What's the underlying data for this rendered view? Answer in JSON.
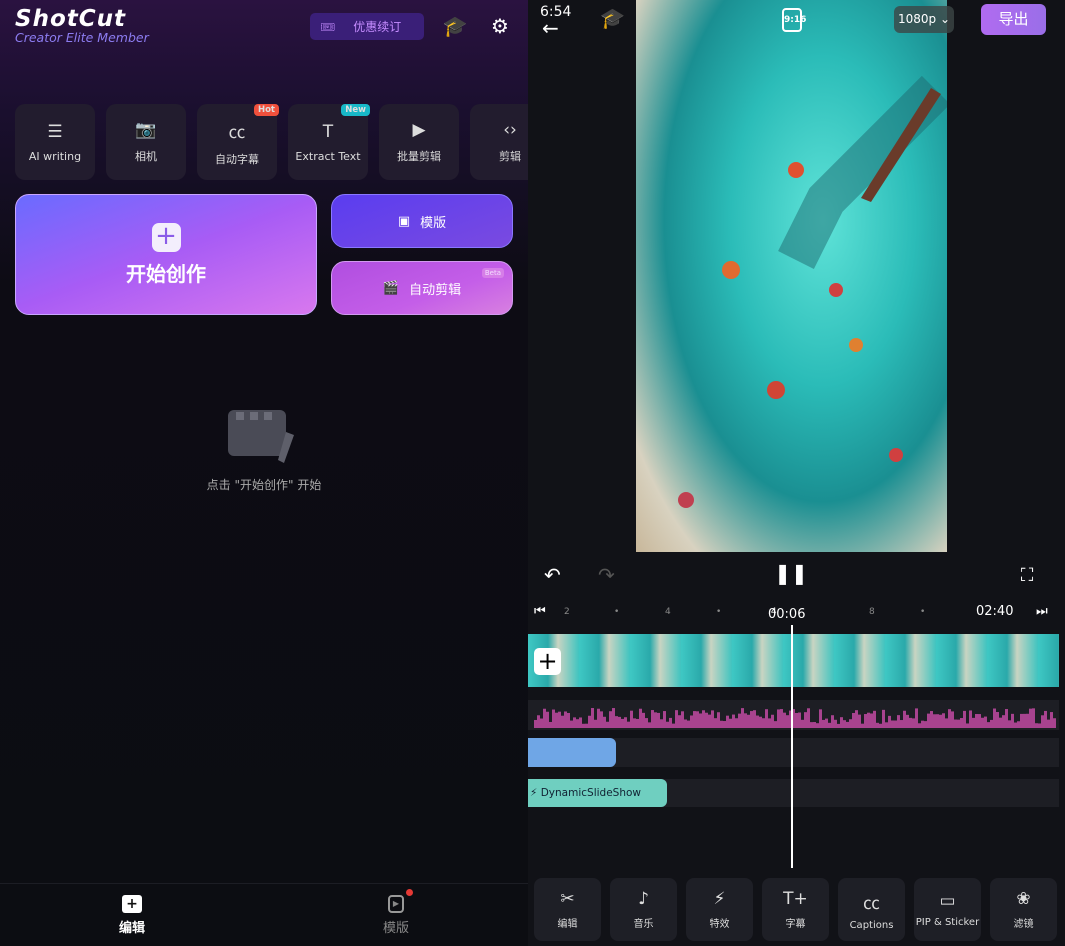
{
  "home": {
    "brand": "ShotCut",
    "member": "Creator Elite Member",
    "renew_label": "优惠续订",
    "tools": [
      {
        "label": "AI writing",
        "icon": "ai-writing-icon"
      },
      {
        "label": "相机",
        "icon": "camera-icon"
      },
      {
        "label": "自动字幕",
        "icon": "auto-captions-icon",
        "badge": "Hot",
        "badge_color": "#f0503c"
      },
      {
        "label": "Extract Text",
        "icon": "extract-text-icon",
        "badge": "New",
        "badge_color": "#18b8c8"
      },
      {
        "label": "批量剪辑",
        "icon": "batch-edit-icon"
      },
      {
        "label": "剪辑",
        "icon": "edit-icon"
      }
    ],
    "start_label": "开始创作",
    "template_label": "模版",
    "auto_edit_label": "自动剪辑",
    "auto_edit_badge": "Beta",
    "empty_text": "点击 \"开始创作\" 开始",
    "nav": [
      {
        "label": "编辑",
        "active": true
      },
      {
        "label": "模版",
        "active": false,
        "dot": true
      }
    ]
  },
  "editor": {
    "status_time": "6:54",
    "aspect": "9:16",
    "resolution": "1080p",
    "export_label": "导出",
    "ruler": {
      "ticks": [
        "2",
        "•",
        "4",
        "•",
        "8",
        "•"
      ],
      "current": "00:06",
      "current_frac": ".4",
      "total": "02:40"
    },
    "effect_clip": "DynamicSlideShow",
    "toolbar": [
      "编辑",
      "音乐",
      "特效",
      "字幕",
      "Captions",
      "PIP & Sticker",
      "滤镜"
    ],
    "colors": {
      "accent": "#a66bf0",
      "audio": "#a8438f",
      "text_clip": "#6fa6e6",
      "effect_clip": "#6fcfc0"
    }
  }
}
